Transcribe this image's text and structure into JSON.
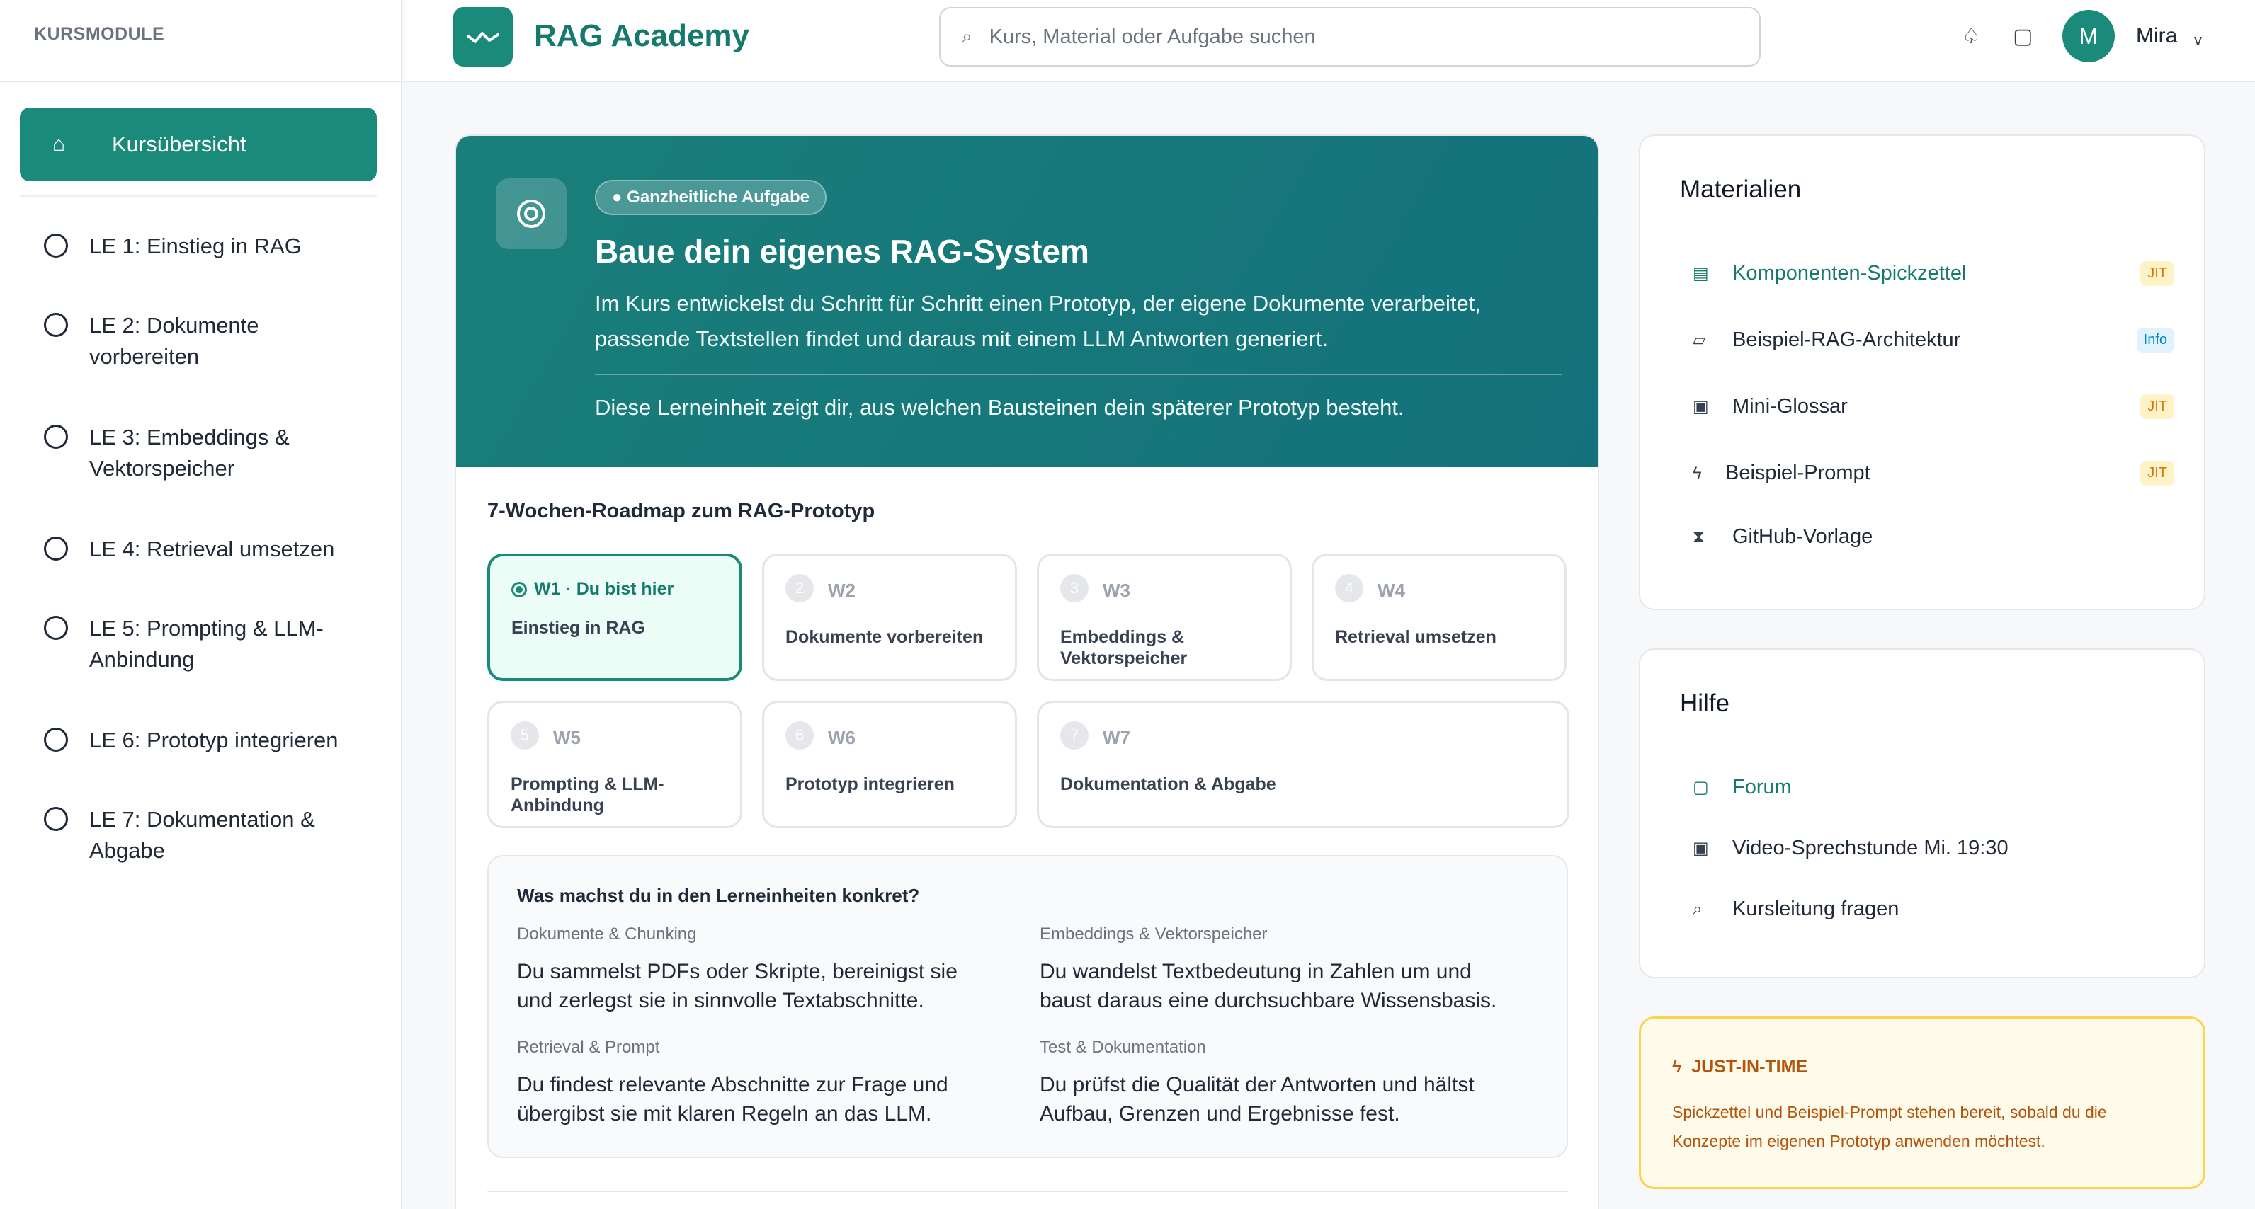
{
  "sidebar": {
    "title": "KURSMODULE",
    "active": {
      "icon": "home-icon",
      "label": "Kursübersicht"
    },
    "items": [
      {
        "label": "LE 1: Einstieg in RAG"
      },
      {
        "label": "LE 2: Dokumente vorbereiten"
      },
      {
        "label": "LE 3: Embeddings & Vektorspeicher"
      },
      {
        "label": "LE 4: Retrieval umsetzen"
      },
      {
        "label": "LE 5: Prompting & LLM-Anbindung"
      },
      {
        "label": "LE 6: Prototyp integrieren"
      },
      {
        "label": "LE 7: Dokumentation & Abgabe"
      }
    ]
  },
  "topbar": {
    "brand": "RAG Academy",
    "search_placeholder": "Kurs, Material oder Aufgabe suchen",
    "user_initial": "M",
    "user_name": "Mira",
    "caret": "v"
  },
  "hero": {
    "badge": "● Ganzheitliche Aufgabe",
    "title": "Baue dein eigenes RAG-System",
    "description": "Im Kurs entwickelst du Schritt für Schritt einen Prototyp, der eigene Dokumente verarbeitet, passende Textstellen findet und daraus mit einem LLM Antworten generiert.",
    "note": "Diese Lerneinheit zeigt dir, aus welchen Bausteinen dein späterer Prototyp besteht."
  },
  "roadmap": {
    "title": "7-Wochen-Roadmap zum RAG-Prototyp",
    "active_label": "W1 · Du bist hier",
    "weeks": [
      {
        "num": "1",
        "label": "W1",
        "name": "Einstieg in RAG"
      },
      {
        "num": "2",
        "label": "W2",
        "name": "Dokumente vorbereiten"
      },
      {
        "num": "3",
        "label": "W3",
        "name": "Embeddings & Vektorspeicher"
      },
      {
        "num": "4",
        "label": "W4",
        "name": "Retrieval umsetzen"
      },
      {
        "num": "5",
        "label": "W5",
        "name": "Prompting & LLM-Anbindung"
      },
      {
        "num": "6",
        "label": "W6",
        "name": "Prototyp integrieren"
      },
      {
        "num": "7",
        "label": "W7",
        "name": "Dokumentation & Abgabe"
      }
    ]
  },
  "activities": {
    "title": "Was machst du in den Lerneinheiten konkret?",
    "items": [
      {
        "caption": "Dokumente & Chunking",
        "text": "Du sammelst PDFs oder Skripte, bereinigst sie und zerlegst sie in sinnvolle Textabschnitte."
      },
      {
        "caption": "Embeddings & Vektorspeicher",
        "text": "Du wandelst Textbedeutung in Zahlen um und baust daraus eine durchsuchbare Wissensbasis."
      },
      {
        "caption": "Retrieval & Prompt",
        "text": "Du findest relevante Abschnitte zur Frage und übergibst sie mit klaren Regeln an das LLM."
      },
      {
        "caption": "Test & Dokumentation",
        "text": "Du prüfst die Qualität der Antworten und hältst Aufbau, Grenzen und Ergebnisse fest."
      }
    ]
  },
  "materials": {
    "title": "Materialien",
    "items": [
      {
        "icon": "document-icon",
        "glyph": "▤",
        "label": "Komponenten-Spickzettel",
        "tag": "JIT"
      },
      {
        "icon": "architecture-icon",
        "glyph": "▱",
        "label": "Beispiel-RAG-Architektur",
        "tag": "Info"
      },
      {
        "icon": "glossary-icon",
        "glyph": "▣",
        "label": "Mini-Glossar",
        "tag": "JIT"
      },
      {
        "icon": "bolt-icon",
        "glyph": "ϟ",
        "label": "Beispiel-Prompt",
        "tag": "JIT"
      },
      {
        "icon": "github-icon",
        "glyph": "⧗",
        "label": "GitHub-Vorlage",
        "tag": ""
      }
    ]
  },
  "help": {
    "title": "Hilfe",
    "items": [
      {
        "icon": "forum-icon",
        "glyph": "▢",
        "label": "Forum"
      },
      {
        "icon": "video-icon",
        "glyph": "▣",
        "label": "Video-Sprechstunde Mi. 19:30"
      },
      {
        "icon": "search-icon",
        "glyph": "⌕",
        "label": "Kursleitung fragen"
      }
    ]
  },
  "jit": {
    "title": "JUST-IN-TIME",
    "text": "Spickzettel und Beispiel-Prompt stehen bereit, sobald du die Konzepte im eigenen Prototyp anwenden möchtest."
  },
  "colors": {
    "accent": "#1a8a7a",
    "hero": "#13717b",
    "jit": "#d97706",
    "info": "#0284c7"
  }
}
